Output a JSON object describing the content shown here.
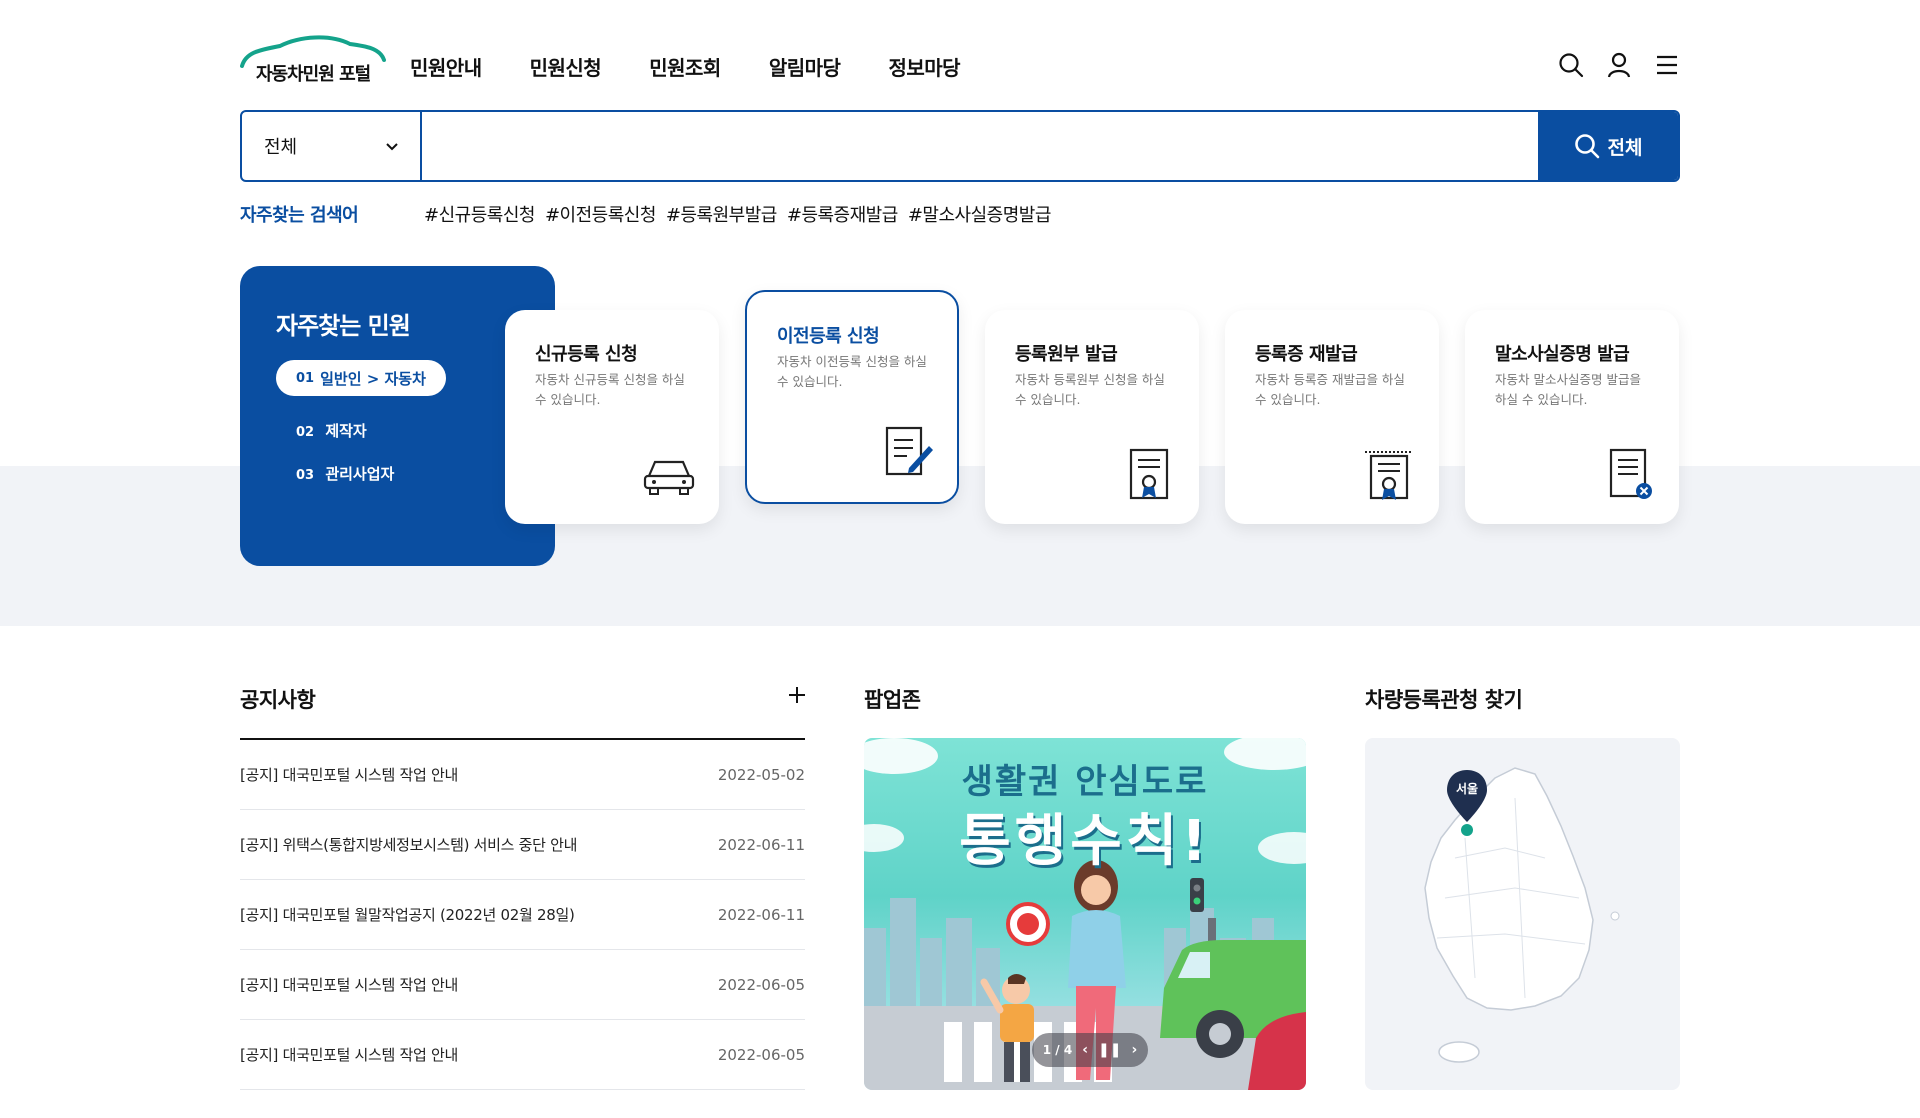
{
  "header": {
    "logo_text": "자동차민원 포털",
    "nav": [
      "민원안내",
      "민원신청",
      "민원조회",
      "알림마당",
      "정보마당"
    ]
  },
  "search": {
    "category": "전체",
    "placeholder": "",
    "button_label": "전체"
  },
  "keywords": {
    "title": "자주찾는 검색어",
    "items": [
      "#신규등록신청",
      "#이전등록신청",
      "#등록원부발급",
      "#등록증재발급",
      "#말소사실증명발급"
    ]
  },
  "frequent": {
    "title": "자주찾는 민원",
    "tabs": [
      {
        "num": "01",
        "label": "일반인 > 자동차"
      },
      {
        "num": "02",
        "label": "제작자"
      },
      {
        "num": "03",
        "label": "관리사업자"
      }
    ]
  },
  "cards": [
    {
      "title": "신규등록 신청",
      "desc": "자동차 신규등록 신청을 하실 수 있습니다.",
      "icon": "car-icon"
    },
    {
      "title": "이전등록 신청",
      "desc": "자동차 이전등록 신청을 하실 수 있습니다.",
      "icon": "document-edit-icon"
    },
    {
      "title": "등록원부 발급",
      "desc": "자동차 등록원부 신청을 하실 수 있습니다.",
      "icon": "certificate-icon"
    },
    {
      "title": "등록증 재발급",
      "desc": "자동차 등록증 재발급을 하실 수 있습니다.",
      "icon": "certificate-reissue-icon"
    },
    {
      "title": "말소사실증명 발급",
      "desc": "자동차 말소사실증명 발급을 하실 수 있습니다.",
      "icon": "document-cancel-icon"
    }
  ],
  "notice": {
    "title": "공지사항",
    "items": [
      {
        "text": "[공지] 대국민포털 시스템 작업 안내",
        "date": "2022-05-02"
      },
      {
        "text": "[공지] 위택스(통합지방세정보시스템) 서비스 중단 안내",
        "date": "2022-06-11"
      },
      {
        "text": "[공지] 대국민포털 월말작업공지 (2022년 02월 28일)",
        "date": "2022-06-11"
      },
      {
        "text": "[공지] 대국민포털 시스템 작업 안내",
        "date": "2022-06-05"
      },
      {
        "text": "[공지] 대국민포털 시스템 작업 안내",
        "date": "2022-06-05"
      }
    ]
  },
  "popup": {
    "title": "팝업존",
    "banner_line1": "생활권 안심도로",
    "banner_line2": "통행수칙!",
    "pager": "1 / 4"
  },
  "office": {
    "title": "차량등록관청 찾기",
    "pin_label": "서울"
  },
  "colors": {
    "primary": "#0a4ea1",
    "band": "#f1f3f7",
    "logo_green": "#14a38b"
  }
}
